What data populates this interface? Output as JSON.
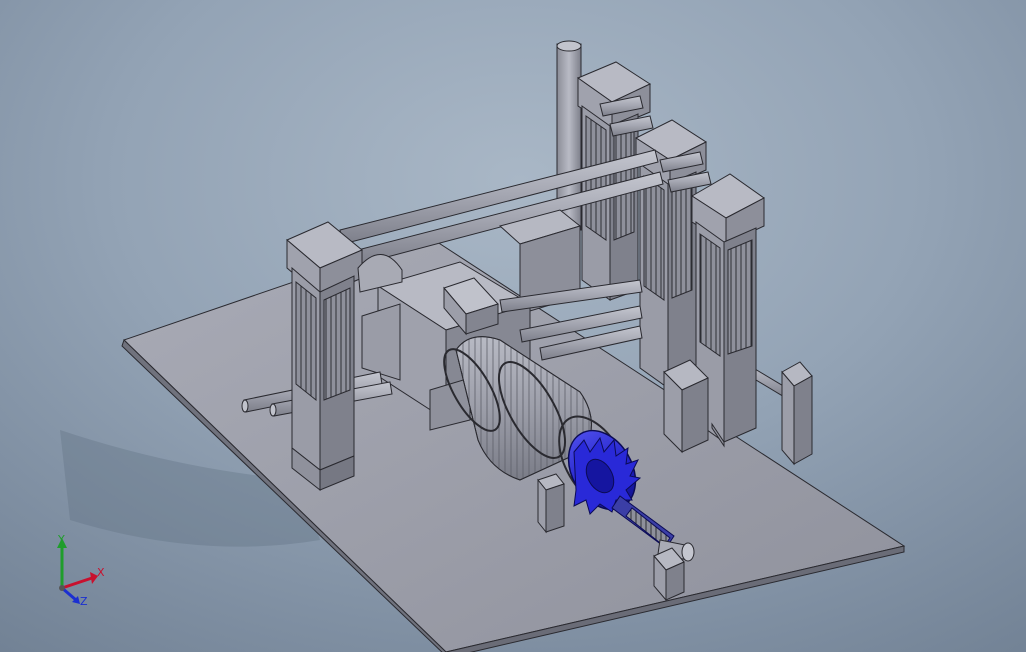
{
  "triad": {
    "x_label": "X",
    "y_label": "Y",
    "z_label": "Z",
    "x_color": "#c8102e",
    "y_color": "#1f9d2b",
    "z_color": "#1b2fd1"
  },
  "model": {
    "part_color": "#a6a8b3",
    "highlight_color": "#1f1fd6",
    "edge_color": "#2a2a30"
  }
}
